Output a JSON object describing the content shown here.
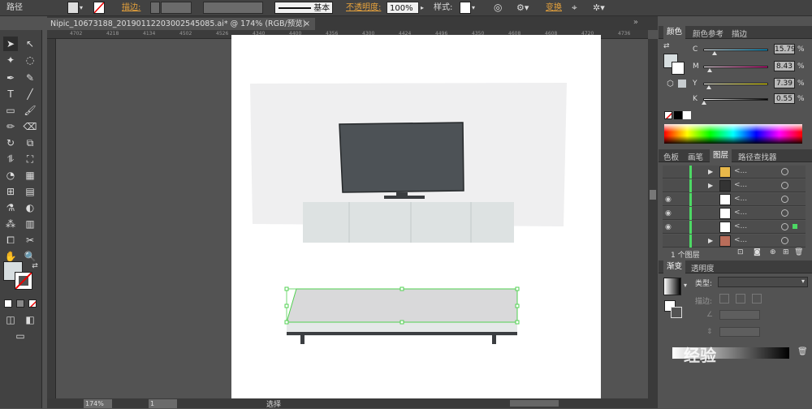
{
  "control_bar": {
    "mode_label": "路径",
    "stroke_label": "描边:",
    "stroke_profile": "基本",
    "opacity_label": "不透明度:",
    "opacity_value": "100%",
    "style_label": "样式:",
    "transform_label": "变换"
  },
  "document_tab": {
    "title": "Nipic_10673188_20190112203002545085.ai* @ 174% (RGB/预览)",
    "close_glyph": "×"
  },
  "ruler_ticks": [
    "4702",
    "4218",
    "4134",
    "4502",
    "4526",
    "4340",
    "4400",
    "4356",
    "4300",
    "4424",
    "4496",
    "4350",
    "4608",
    "4608",
    "4720",
    "4736"
  ],
  "color_panel": {
    "tabs": [
      "颜色",
      "颜色参考",
      "描边"
    ],
    "channels": [
      {
        "label": "C",
        "value": "15.79",
        "percent": 15.79,
        "gradient": "#ffffff,#00aeef"
      },
      {
        "label": "M",
        "value": "8.43",
        "percent": 8.43,
        "gradient": "#ffffff,#ec008c"
      },
      {
        "label": "Y",
        "value": "7.39",
        "percent": 7.39,
        "gradient": "#ffffff,#fff200"
      },
      {
        "label": "K",
        "value": "0.55",
        "percent": 0.55,
        "gradient": "#ffffff,#000000"
      }
    ],
    "unit": "%"
  },
  "layers_panel": {
    "tabs": [
      "色板",
      "画笔",
      "图层",
      "路径查找器"
    ],
    "active_tab": "图层",
    "rows": [
      {
        "name": "<...",
        "eye": "",
        "expand": "▶",
        "thumb": "#e8b84a"
      },
      {
        "name": "<...",
        "eye": "",
        "expand": "▶",
        "thumb": "#333333"
      },
      {
        "name": "<...",
        "eye": "◉",
        "expand": "",
        "thumb": "#ffffff"
      },
      {
        "name": "<...",
        "eye": "◉",
        "expand": "",
        "thumb": "#ffffff"
      },
      {
        "name": "<...",
        "eye": "◉",
        "expand": "",
        "thumb": "#ffffff"
      },
      {
        "name": "<...",
        "eye": "",
        "expand": "▶",
        "thumb": "#b86d5a"
      }
    ],
    "footer_label": "1 个图层"
  },
  "gradient_panel": {
    "tabs": [
      "渐变",
      "透明度"
    ],
    "type_label": "类型:",
    "stroke_label": "描边:"
  },
  "status_bar": {
    "zoom": "174%",
    "page": "1",
    "tool": "选择"
  },
  "watermark": {
    "text": "经验"
  }
}
